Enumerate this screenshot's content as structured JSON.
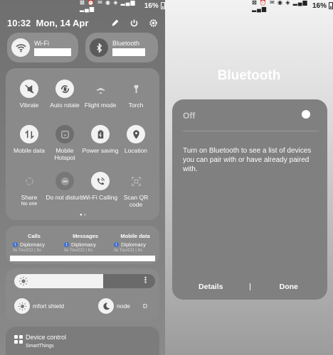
{
  "status": {
    "battery": "16%",
    "icons": "⊠ ⏰ ✉ ◉ ◈ ▂▄▆ ▂▄▆"
  },
  "quick_panel": {
    "time": "10:32",
    "date": "Mon, 14 Apr",
    "wifi_label": "Wi-Fi",
    "bluetooth_label": "Bluetooth",
    "tiles": [
      {
        "label": "Vibrate",
        "icon": "vibrate-icon",
        "active": true
      },
      {
        "label": "Auto rotate",
        "icon": "auto-rotate-icon",
        "active": true
      },
      {
        "label": "Flight mode",
        "icon": "airplane-icon",
        "active": false
      },
      {
        "label": "Torch",
        "icon": "torch-icon",
        "active": false
      },
      {
        "label": "Mobile data",
        "icon": "mobile-data-icon",
        "active": true
      },
      {
        "label": "Mobile Hotspot",
        "icon": "hotspot-icon",
        "active": false
      },
      {
        "label": "Power saving",
        "icon": "battery-icon",
        "active": true
      },
      {
        "label": "Location",
        "icon": "location-icon",
        "active": true
      },
      {
        "label": "Share",
        "sublabel": "No one",
        "icon": "share-icon",
        "active": false
      },
      {
        "label": "Do not disturb",
        "icon": "do-not-disturb-icon",
        "active": false
      },
      {
        "label": "Wi-Fi Calling",
        "icon": "wifi-calling-icon",
        "active": true
      },
      {
        "label": "Scan QR code",
        "icon": "qr-scan-icon",
        "active": false
      }
    ],
    "usage": [
      {
        "header": "Calls",
        "sim": "Diplomacy",
        "value": "Ilo TourCO | Ilo"
      },
      {
        "header": "Messages",
        "sim": "Diplomacy",
        "value": "Ilo TourCO | Ilo"
      },
      {
        "header": "Mobile data",
        "sim": "Diplomacy",
        "value": "Ilo TourCO | Ilo"
      }
    ],
    "brightness_level": 0.63,
    "eye_comfort_label": "mfort shield",
    "dark_mode_label": "node",
    "dark_mode_trail": "D",
    "device_control": {
      "title": "Device control",
      "subtitle": "SmartThings"
    },
    "colors": {
      "active_tile": "#f2f2f2",
      "panel": "#8a8a8a",
      "sim_badge": "#3b6fd4"
    }
  },
  "bluetooth_dialog": {
    "title": "Bluetooth",
    "state": "Off",
    "message": "Turn on Bluetooth to see a list of devices you can pair with or have already paired with.",
    "details_label": "Details",
    "done_label": "Done"
  }
}
